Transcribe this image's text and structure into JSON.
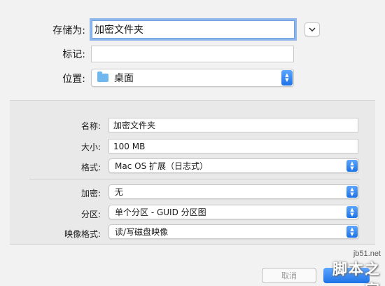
{
  "save_as": {
    "label": "存储为:",
    "value": "加密文件夹"
  },
  "tags": {
    "label": "标记:",
    "value": ""
  },
  "where": {
    "label": "位置:",
    "value": "桌面",
    "icon": "folder-icon"
  },
  "form": {
    "name": {
      "label": "名称:",
      "value": "加密文件夹"
    },
    "size": {
      "label": "大小:",
      "value": "100 MB"
    },
    "format": {
      "label": "格式:",
      "value": "Mac OS 扩展（日志式）"
    },
    "encryption": {
      "label": "加密:",
      "value": "无"
    },
    "partitions": {
      "label": "分区:",
      "value": "单个分区 - GUID 分区图"
    },
    "image_format": {
      "label": "映像格式:",
      "value": "读/写磁盘映像"
    }
  },
  "footer": {
    "cancel_partial": "取消",
    "save_partial": ""
  },
  "watermark": {
    "url": "jb51.net",
    "name": "脚本之家"
  },
  "colors": {
    "accent": "#1c72e6",
    "focus_ring": "#8fb7ea",
    "folder": "#6fb7ef"
  }
}
